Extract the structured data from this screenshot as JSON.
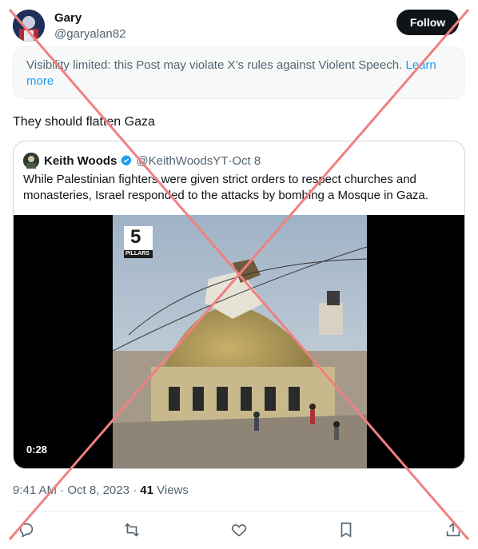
{
  "author": {
    "name": "Gary",
    "handle": "@garyalan82",
    "follow_label": "Follow"
  },
  "notice": {
    "text": "Visibility limited: this Post may violate X’s rules against Violent Speech. ",
    "link": "Learn more"
  },
  "tweet": {
    "text": "They should flatten Gaza"
  },
  "quote": {
    "name": "Keith Woods",
    "handle": "@KeithWoodsYT",
    "separator": " · ",
    "date": "Oct 8",
    "text": "While Palestinian fighters were given strict orders to respect churches and monasteries, Israel responded to the attacks by bombing a Mosque in Gaza.",
    "video": {
      "duration": "0:28",
      "logo_number": "5",
      "logo_text": "PILLARS"
    }
  },
  "meta": {
    "time": "9:41 AM",
    "separator": " · ",
    "date": "Oct 8, 2023",
    "sep2": " · ",
    "views_count": "41",
    "views_label": " Views"
  },
  "icons": {
    "reply": "reply-icon",
    "retweet": "retweet-icon",
    "like": "like-icon",
    "bookmark": "bookmark-icon",
    "share": "share-icon",
    "verified": "verified-badge-icon"
  },
  "colors": {
    "accent": "#1d9bf0",
    "text": "#0f1419",
    "secondary": "#536471",
    "overlay_cross": "#f08080"
  }
}
